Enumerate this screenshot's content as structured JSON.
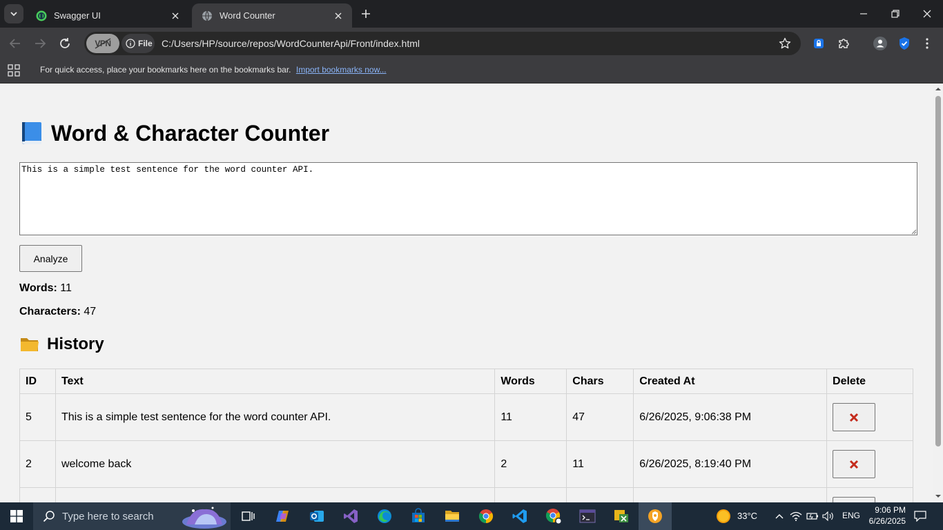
{
  "browser": {
    "tabs": [
      {
        "title": "Swagger UI",
        "icon": "swagger-icon",
        "active": false
      },
      {
        "title": "Word Counter",
        "icon": "globe-icon",
        "active": true
      }
    ],
    "vpn_label": "VPN",
    "site_chip_label": "File",
    "url": "C:/Users/HP/source/repos/WordCounterApi/Front/index.html",
    "bookmarks_bar": {
      "message": "For quick access, place your bookmarks here on the bookmarks bar.",
      "link": "Import bookmarks now..."
    }
  },
  "page": {
    "title": "Word & Character Counter",
    "title_icon": "blue-book-icon",
    "textarea_value": "This is a simple test sentence for the word counter API.",
    "analyze_label": "Analyze",
    "words_label": "Words:",
    "words_value": "11",
    "chars_label": "Characters:",
    "chars_value": "47",
    "history_title": "History",
    "history_icon": "folder-icon",
    "table": {
      "headers": [
        "ID",
        "Text",
        "Words",
        "Chars",
        "Created At",
        "Delete"
      ],
      "rows": [
        {
          "id": "5",
          "text": "This is a simple test sentence for the word counter API.",
          "words": "11",
          "chars": "47",
          "created": "6/26/2025, 9:06:38 PM"
        },
        {
          "id": "2",
          "text": "welcome back",
          "words": "2",
          "chars": "11",
          "created": "6/26/2025, 8:19:40 PM"
        }
      ]
    }
  },
  "taskbar": {
    "search_placeholder": "Type here to search",
    "weather": "33°C",
    "language": "ENG",
    "time": "9:06 PM",
    "date": "6/26/2025"
  },
  "colors": {
    "page_bg": "#f2f2f2",
    "chrome_dark": "#202124",
    "chrome_toolbar": "#3c3c3f",
    "link": "#8ab4f8",
    "delete_x": "#c42b1c",
    "taskbar": "#1c2a38"
  }
}
